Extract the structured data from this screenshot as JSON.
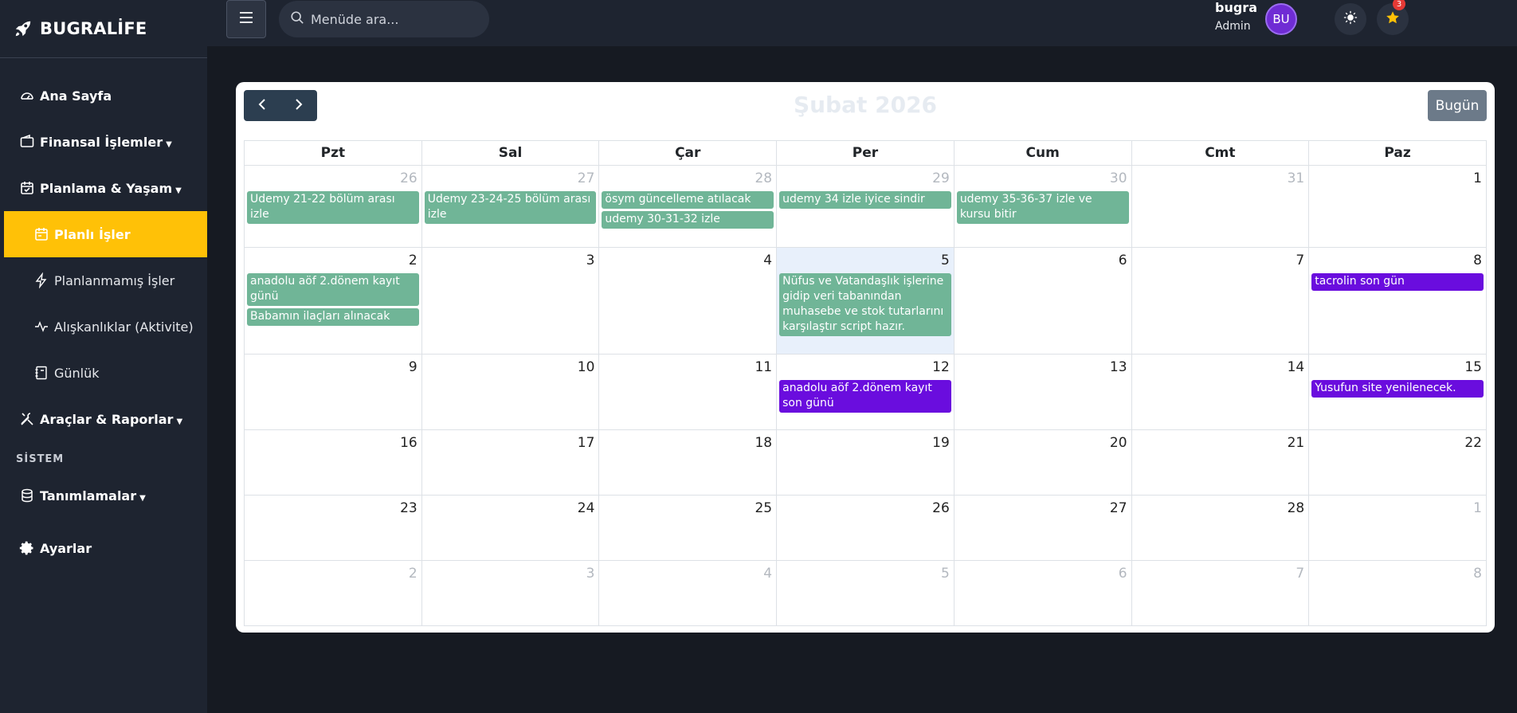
{
  "brand": {
    "name": "BUGRALİFE"
  },
  "sidebar": {
    "items": [
      {
        "label": "Ana Sayfa",
        "icon": "dashboard-icon"
      },
      {
        "label": "Finansal İşlemler",
        "icon": "wallet-icon"
      },
      {
        "label": "Planlama & Yaşam",
        "icon": "calendar-check-icon"
      },
      {
        "label": "Planlı İşler",
        "icon": "calendar-icon",
        "active": true
      },
      {
        "label": "Planlanmamış İşler",
        "icon": "bolt-icon"
      },
      {
        "label": "Alışkanlıklar (Aktivite)",
        "icon": "activity-icon"
      },
      {
        "label": "Günlük",
        "icon": "journal-icon"
      },
      {
        "label": "Araçlar & Raporlar",
        "icon": "tools-icon"
      },
      {
        "label": "Tanımlamalar",
        "icon": "database-icon"
      },
      {
        "label": "Ayarlar",
        "icon": "gear-icon"
      }
    ],
    "section_label": "SİSTEM"
  },
  "topbar": {
    "search_placeholder": "Menüde ara...",
    "notification_count": "3",
    "user_name": "bugra",
    "user_role": "Admin",
    "avatar_initials": "BU"
  },
  "calendar": {
    "title": "Şubat 2026",
    "today_label": "Bugün",
    "weekdays": [
      "Pzt",
      "Sal",
      "Çar",
      "Per",
      "Cum",
      "Cmt",
      "Paz"
    ],
    "weeks": [
      [
        {
          "day": "26",
          "other": true,
          "events": [
            {
              "text": "Udemy 21-22 bölüm arası izle",
              "color": "green"
            }
          ]
        },
        {
          "day": "27",
          "other": true,
          "events": [
            {
              "text": "Udemy 23-24-25 bölüm arası izle",
              "color": "green"
            }
          ]
        },
        {
          "day": "28",
          "other": true,
          "events": [
            {
              "text": "ösym güncelleme atılacak",
              "color": "green"
            },
            {
              "text": "udemy 30-31-32 izle",
              "color": "green"
            }
          ]
        },
        {
          "day": "29",
          "other": true,
          "events": [
            {
              "text": "udemy 34 izle iyice sindir",
              "color": "green"
            }
          ]
        },
        {
          "day": "30",
          "other": true,
          "events": [
            {
              "text": "udemy 35-36-37 izle ve kursu bitir",
              "color": "green"
            }
          ]
        },
        {
          "day": "31",
          "other": true,
          "events": []
        },
        {
          "day": "1",
          "other": false,
          "events": []
        }
      ],
      [
        {
          "day": "2",
          "other": false,
          "events": [
            {
              "text": "anadolu aöf 2.dönem kayıt günü",
              "color": "green"
            },
            {
              "text": "Babamın ilaçları alınacak",
              "color": "green"
            }
          ]
        },
        {
          "day": "3",
          "other": false,
          "events": []
        },
        {
          "day": "4",
          "other": false,
          "events": []
        },
        {
          "day": "5",
          "other": false,
          "today": true,
          "events": [
            {
              "text": "Nüfus ve Vatandaşlık işlerine gidip veri tabanından muhasebe ve stok tutarlarını karşılaştır script hazır.",
              "color": "green"
            }
          ]
        },
        {
          "day": "6",
          "other": false,
          "events": []
        },
        {
          "day": "7",
          "other": false,
          "events": []
        },
        {
          "day": "8",
          "other": false,
          "events": [
            {
              "text": "tacrolin son gün",
              "color": "purple"
            }
          ]
        }
      ],
      [
        {
          "day": "9",
          "other": false,
          "events": []
        },
        {
          "day": "10",
          "other": false,
          "events": []
        },
        {
          "day": "11",
          "other": false,
          "events": []
        },
        {
          "day": "12",
          "other": false,
          "events": [
            {
              "text": "anadolu aöf 2.dönem kayıt son günü",
              "color": "purple"
            }
          ]
        },
        {
          "day": "13",
          "other": false,
          "events": []
        },
        {
          "day": "14",
          "other": false,
          "events": []
        },
        {
          "day": "15",
          "other": false,
          "events": [
            {
              "text": "Yusufun site yenilenecek.",
              "color": "purple"
            }
          ]
        }
      ],
      [
        {
          "day": "16",
          "other": false,
          "events": []
        },
        {
          "day": "17",
          "other": false,
          "events": []
        },
        {
          "day": "18",
          "other": false,
          "events": []
        },
        {
          "day": "19",
          "other": false,
          "events": []
        },
        {
          "day": "20",
          "other": false,
          "events": []
        },
        {
          "day": "21",
          "other": false,
          "events": []
        },
        {
          "day": "22",
          "other": false,
          "events": []
        }
      ],
      [
        {
          "day": "23",
          "other": false,
          "events": []
        },
        {
          "day": "24",
          "other": false,
          "events": []
        },
        {
          "day": "25",
          "other": false,
          "events": []
        },
        {
          "day": "26",
          "other": false,
          "events": []
        },
        {
          "day": "27",
          "other": false,
          "events": []
        },
        {
          "day": "28",
          "other": false,
          "events": []
        },
        {
          "day": "1",
          "other": true,
          "events": []
        }
      ],
      [
        {
          "day": "2",
          "other": true,
          "events": []
        },
        {
          "day": "3",
          "other": true,
          "events": []
        },
        {
          "day": "4",
          "other": true,
          "events": []
        },
        {
          "day": "5",
          "other": true,
          "events": []
        },
        {
          "day": "6",
          "other": true,
          "events": []
        },
        {
          "day": "7",
          "other": true,
          "events": []
        },
        {
          "day": "8",
          "other": true,
          "events": []
        }
      ]
    ]
  },
  "colors": {
    "accent": "#ffc107",
    "event_green": "#70b597",
    "event_purple": "#6a0dde",
    "sidebar_bg": "#1e2430",
    "page_bg": "#161a22"
  }
}
